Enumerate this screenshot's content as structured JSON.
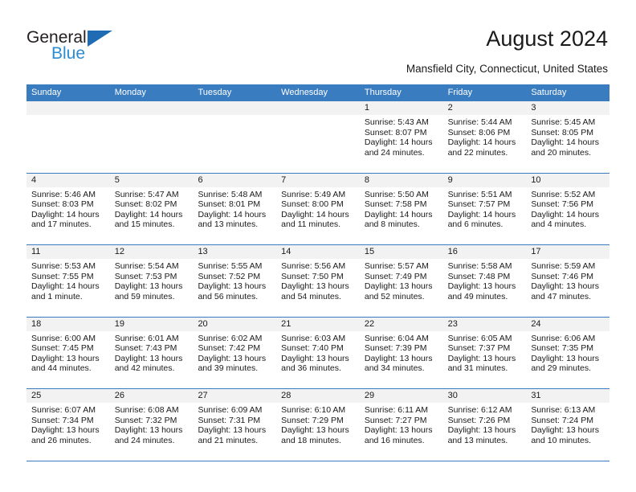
{
  "brand": {
    "word1": "General",
    "word2": "Blue",
    "accent_color": "#1f6cb4",
    "accent_color_light": "#2b8cd4"
  },
  "header": {
    "title": "August 2024",
    "subtitle": "Mansfield City, Connecticut, United States"
  },
  "theme": {
    "header_blue": "#3a7cc0",
    "daynum_bg": "#f2f2f2"
  },
  "weekdays": [
    "Sunday",
    "Monday",
    "Tuesday",
    "Wednesday",
    "Thursday",
    "Friday",
    "Saturday"
  ],
  "weeks": [
    [
      {
        "day": "",
        "sunrise": "",
        "sunset": "",
        "daylight": "",
        "empty": true
      },
      {
        "day": "",
        "sunrise": "",
        "sunset": "",
        "daylight": "",
        "empty": true
      },
      {
        "day": "",
        "sunrise": "",
        "sunset": "",
        "daylight": "",
        "empty": true
      },
      {
        "day": "",
        "sunrise": "",
        "sunset": "",
        "daylight": "",
        "empty": true
      },
      {
        "day": "1",
        "sunrise": "Sunrise: 5:43 AM",
        "sunset": "Sunset: 8:07 PM",
        "daylight": "Daylight: 14 hours and 24 minutes."
      },
      {
        "day": "2",
        "sunrise": "Sunrise: 5:44 AM",
        "sunset": "Sunset: 8:06 PM",
        "daylight": "Daylight: 14 hours and 22 minutes."
      },
      {
        "day": "3",
        "sunrise": "Sunrise: 5:45 AM",
        "sunset": "Sunset: 8:05 PM",
        "daylight": "Daylight: 14 hours and 20 minutes."
      }
    ],
    [
      {
        "day": "4",
        "sunrise": "Sunrise: 5:46 AM",
        "sunset": "Sunset: 8:03 PM",
        "daylight": "Daylight: 14 hours and 17 minutes."
      },
      {
        "day": "5",
        "sunrise": "Sunrise: 5:47 AM",
        "sunset": "Sunset: 8:02 PM",
        "daylight": "Daylight: 14 hours and 15 minutes."
      },
      {
        "day": "6",
        "sunrise": "Sunrise: 5:48 AM",
        "sunset": "Sunset: 8:01 PM",
        "daylight": "Daylight: 14 hours and 13 minutes."
      },
      {
        "day": "7",
        "sunrise": "Sunrise: 5:49 AM",
        "sunset": "Sunset: 8:00 PM",
        "daylight": "Daylight: 14 hours and 11 minutes."
      },
      {
        "day": "8",
        "sunrise": "Sunrise: 5:50 AM",
        "sunset": "Sunset: 7:58 PM",
        "daylight": "Daylight: 14 hours and 8 minutes."
      },
      {
        "day": "9",
        "sunrise": "Sunrise: 5:51 AM",
        "sunset": "Sunset: 7:57 PM",
        "daylight": "Daylight: 14 hours and 6 minutes."
      },
      {
        "day": "10",
        "sunrise": "Sunrise: 5:52 AM",
        "sunset": "Sunset: 7:56 PM",
        "daylight": "Daylight: 14 hours and 4 minutes."
      }
    ],
    [
      {
        "day": "11",
        "sunrise": "Sunrise: 5:53 AM",
        "sunset": "Sunset: 7:55 PM",
        "daylight": "Daylight: 14 hours and 1 minute."
      },
      {
        "day": "12",
        "sunrise": "Sunrise: 5:54 AM",
        "sunset": "Sunset: 7:53 PM",
        "daylight": "Daylight: 13 hours and 59 minutes."
      },
      {
        "day": "13",
        "sunrise": "Sunrise: 5:55 AM",
        "sunset": "Sunset: 7:52 PM",
        "daylight": "Daylight: 13 hours and 56 minutes."
      },
      {
        "day": "14",
        "sunrise": "Sunrise: 5:56 AM",
        "sunset": "Sunset: 7:50 PM",
        "daylight": "Daylight: 13 hours and 54 minutes."
      },
      {
        "day": "15",
        "sunrise": "Sunrise: 5:57 AM",
        "sunset": "Sunset: 7:49 PM",
        "daylight": "Daylight: 13 hours and 52 minutes."
      },
      {
        "day": "16",
        "sunrise": "Sunrise: 5:58 AM",
        "sunset": "Sunset: 7:48 PM",
        "daylight": "Daylight: 13 hours and 49 minutes."
      },
      {
        "day": "17",
        "sunrise": "Sunrise: 5:59 AM",
        "sunset": "Sunset: 7:46 PM",
        "daylight": "Daylight: 13 hours and 47 minutes."
      }
    ],
    [
      {
        "day": "18",
        "sunrise": "Sunrise: 6:00 AM",
        "sunset": "Sunset: 7:45 PM",
        "daylight": "Daylight: 13 hours and 44 minutes."
      },
      {
        "day": "19",
        "sunrise": "Sunrise: 6:01 AM",
        "sunset": "Sunset: 7:43 PM",
        "daylight": "Daylight: 13 hours and 42 minutes."
      },
      {
        "day": "20",
        "sunrise": "Sunrise: 6:02 AM",
        "sunset": "Sunset: 7:42 PM",
        "daylight": "Daylight: 13 hours and 39 minutes."
      },
      {
        "day": "21",
        "sunrise": "Sunrise: 6:03 AM",
        "sunset": "Sunset: 7:40 PM",
        "daylight": "Daylight: 13 hours and 36 minutes."
      },
      {
        "day": "22",
        "sunrise": "Sunrise: 6:04 AM",
        "sunset": "Sunset: 7:39 PM",
        "daylight": "Daylight: 13 hours and 34 minutes."
      },
      {
        "day": "23",
        "sunrise": "Sunrise: 6:05 AM",
        "sunset": "Sunset: 7:37 PM",
        "daylight": "Daylight: 13 hours and 31 minutes."
      },
      {
        "day": "24",
        "sunrise": "Sunrise: 6:06 AM",
        "sunset": "Sunset: 7:35 PM",
        "daylight": "Daylight: 13 hours and 29 minutes."
      }
    ],
    [
      {
        "day": "25",
        "sunrise": "Sunrise: 6:07 AM",
        "sunset": "Sunset: 7:34 PM",
        "daylight": "Daylight: 13 hours and 26 minutes."
      },
      {
        "day": "26",
        "sunrise": "Sunrise: 6:08 AM",
        "sunset": "Sunset: 7:32 PM",
        "daylight": "Daylight: 13 hours and 24 minutes."
      },
      {
        "day": "27",
        "sunrise": "Sunrise: 6:09 AM",
        "sunset": "Sunset: 7:31 PM",
        "daylight": "Daylight: 13 hours and 21 minutes."
      },
      {
        "day": "28",
        "sunrise": "Sunrise: 6:10 AM",
        "sunset": "Sunset: 7:29 PM",
        "daylight": "Daylight: 13 hours and 18 minutes."
      },
      {
        "day": "29",
        "sunrise": "Sunrise: 6:11 AM",
        "sunset": "Sunset: 7:27 PM",
        "daylight": "Daylight: 13 hours and 16 minutes."
      },
      {
        "day": "30",
        "sunrise": "Sunrise: 6:12 AM",
        "sunset": "Sunset: 7:26 PM",
        "daylight": "Daylight: 13 hours and 13 minutes."
      },
      {
        "day": "31",
        "sunrise": "Sunrise: 6:13 AM",
        "sunset": "Sunset: 7:24 PM",
        "daylight": "Daylight: 13 hours and 10 minutes."
      }
    ]
  ]
}
